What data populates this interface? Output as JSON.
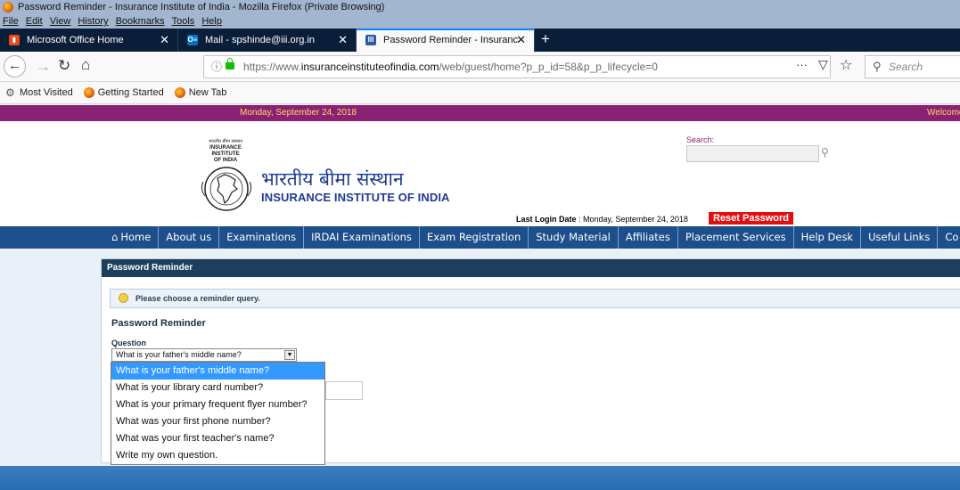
{
  "window": {
    "title": "Password Reminder - Insurance Institute of India - Mozilla Firefox (Private Browsing)"
  },
  "menubar": {
    "items": [
      "File",
      "Edit",
      "View",
      "History",
      "Bookmarks",
      "Tools",
      "Help"
    ]
  },
  "tabs": [
    {
      "label": "Microsoft Office Home",
      "icon": "office-icon",
      "color": "#e74c1c",
      "active": false
    },
    {
      "label": "Mail - spshinde@iii.org.in",
      "icon": "outlook-icon",
      "color": "#0072c6",
      "active": false
    },
    {
      "label": "Password Reminder - Insuranc",
      "icon": "site-icon",
      "color": "#2b5aa8",
      "active": true
    }
  ],
  "toolbar": {
    "url_prefix": "https://www.",
    "url_domain": "insuranceinstituteofindia.com",
    "url_path": "/web/guest/home?p_p_id=58&p_p_lifecycle=0",
    "more_label": "···",
    "search_placeholder": "Search"
  },
  "bookmarks": [
    {
      "label": "Most Visited",
      "icon": "gear-icon"
    },
    {
      "label": "Getting Started",
      "icon": "firefox-icon"
    },
    {
      "label": "New Tab",
      "icon": "firefox-icon"
    }
  ],
  "topbar": {
    "date": "Monday, September 24, 2018",
    "welcome": "Welcome"
  },
  "header": {
    "logo_text": [
      "भारतीय बीमा संस्थान",
      "INSURANCE",
      "INSTITUTE",
      "OF INDIA"
    ],
    "hindi_title": "भारतीय बीमा संस्थान",
    "english_title": "INSURANCE INSTITUTE OF INDIA",
    "search_label": "Search:",
    "last_login_label": "Last Login Date",
    "last_login_value": ": Monday, September 24, 2018",
    "reset_label": "Reset Password"
  },
  "nav": {
    "items": [
      "Home",
      "About us",
      "Examinations",
      "IRDAI Examinations",
      "Exam Registration",
      "Study Material",
      "Affiliates",
      "Placement Services",
      "Help Desk",
      "Useful Links",
      "Co"
    ]
  },
  "panel": {
    "title": "Password Reminder",
    "info": "Please choose a reminder query.",
    "section_title": "Password Reminder",
    "question_label": "Question",
    "selected_question": "What is your father's middle name?",
    "options": [
      "What is your father's middle name?",
      "What is your library card number?",
      "What is your primary frequent flyer number?",
      "What was your first phone number?",
      "What was your first teacher's name?",
      "Write my own question."
    ]
  }
}
